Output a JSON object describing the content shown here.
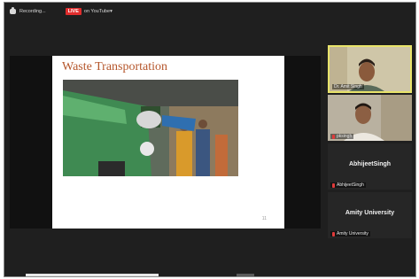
{
  "topbar": {
    "recording_label": "Recording...",
    "live_badge": "LIVE",
    "youtube_label": "on YouTube"
  },
  "slide": {
    "title": "Waste Transportation",
    "page_number": "11"
  },
  "participants": [
    {
      "name": "Dr. Amit Singh",
      "active_speaker": true,
      "muted": false
    },
    {
      "name": "pksingh",
      "active_speaker": false,
      "muted": true
    },
    {
      "name": "AbhijeetSingh",
      "display_name": "AbhijeetSingh",
      "active_speaker": false,
      "muted": true
    },
    {
      "name": "Amity University",
      "display_name": "Amity University",
      "active_speaker": false,
      "muted": true
    }
  ],
  "colors": {
    "live_red": "#e02d2d",
    "active_speaker_border": "#e8e36a",
    "slide_title": "#b5562b"
  }
}
